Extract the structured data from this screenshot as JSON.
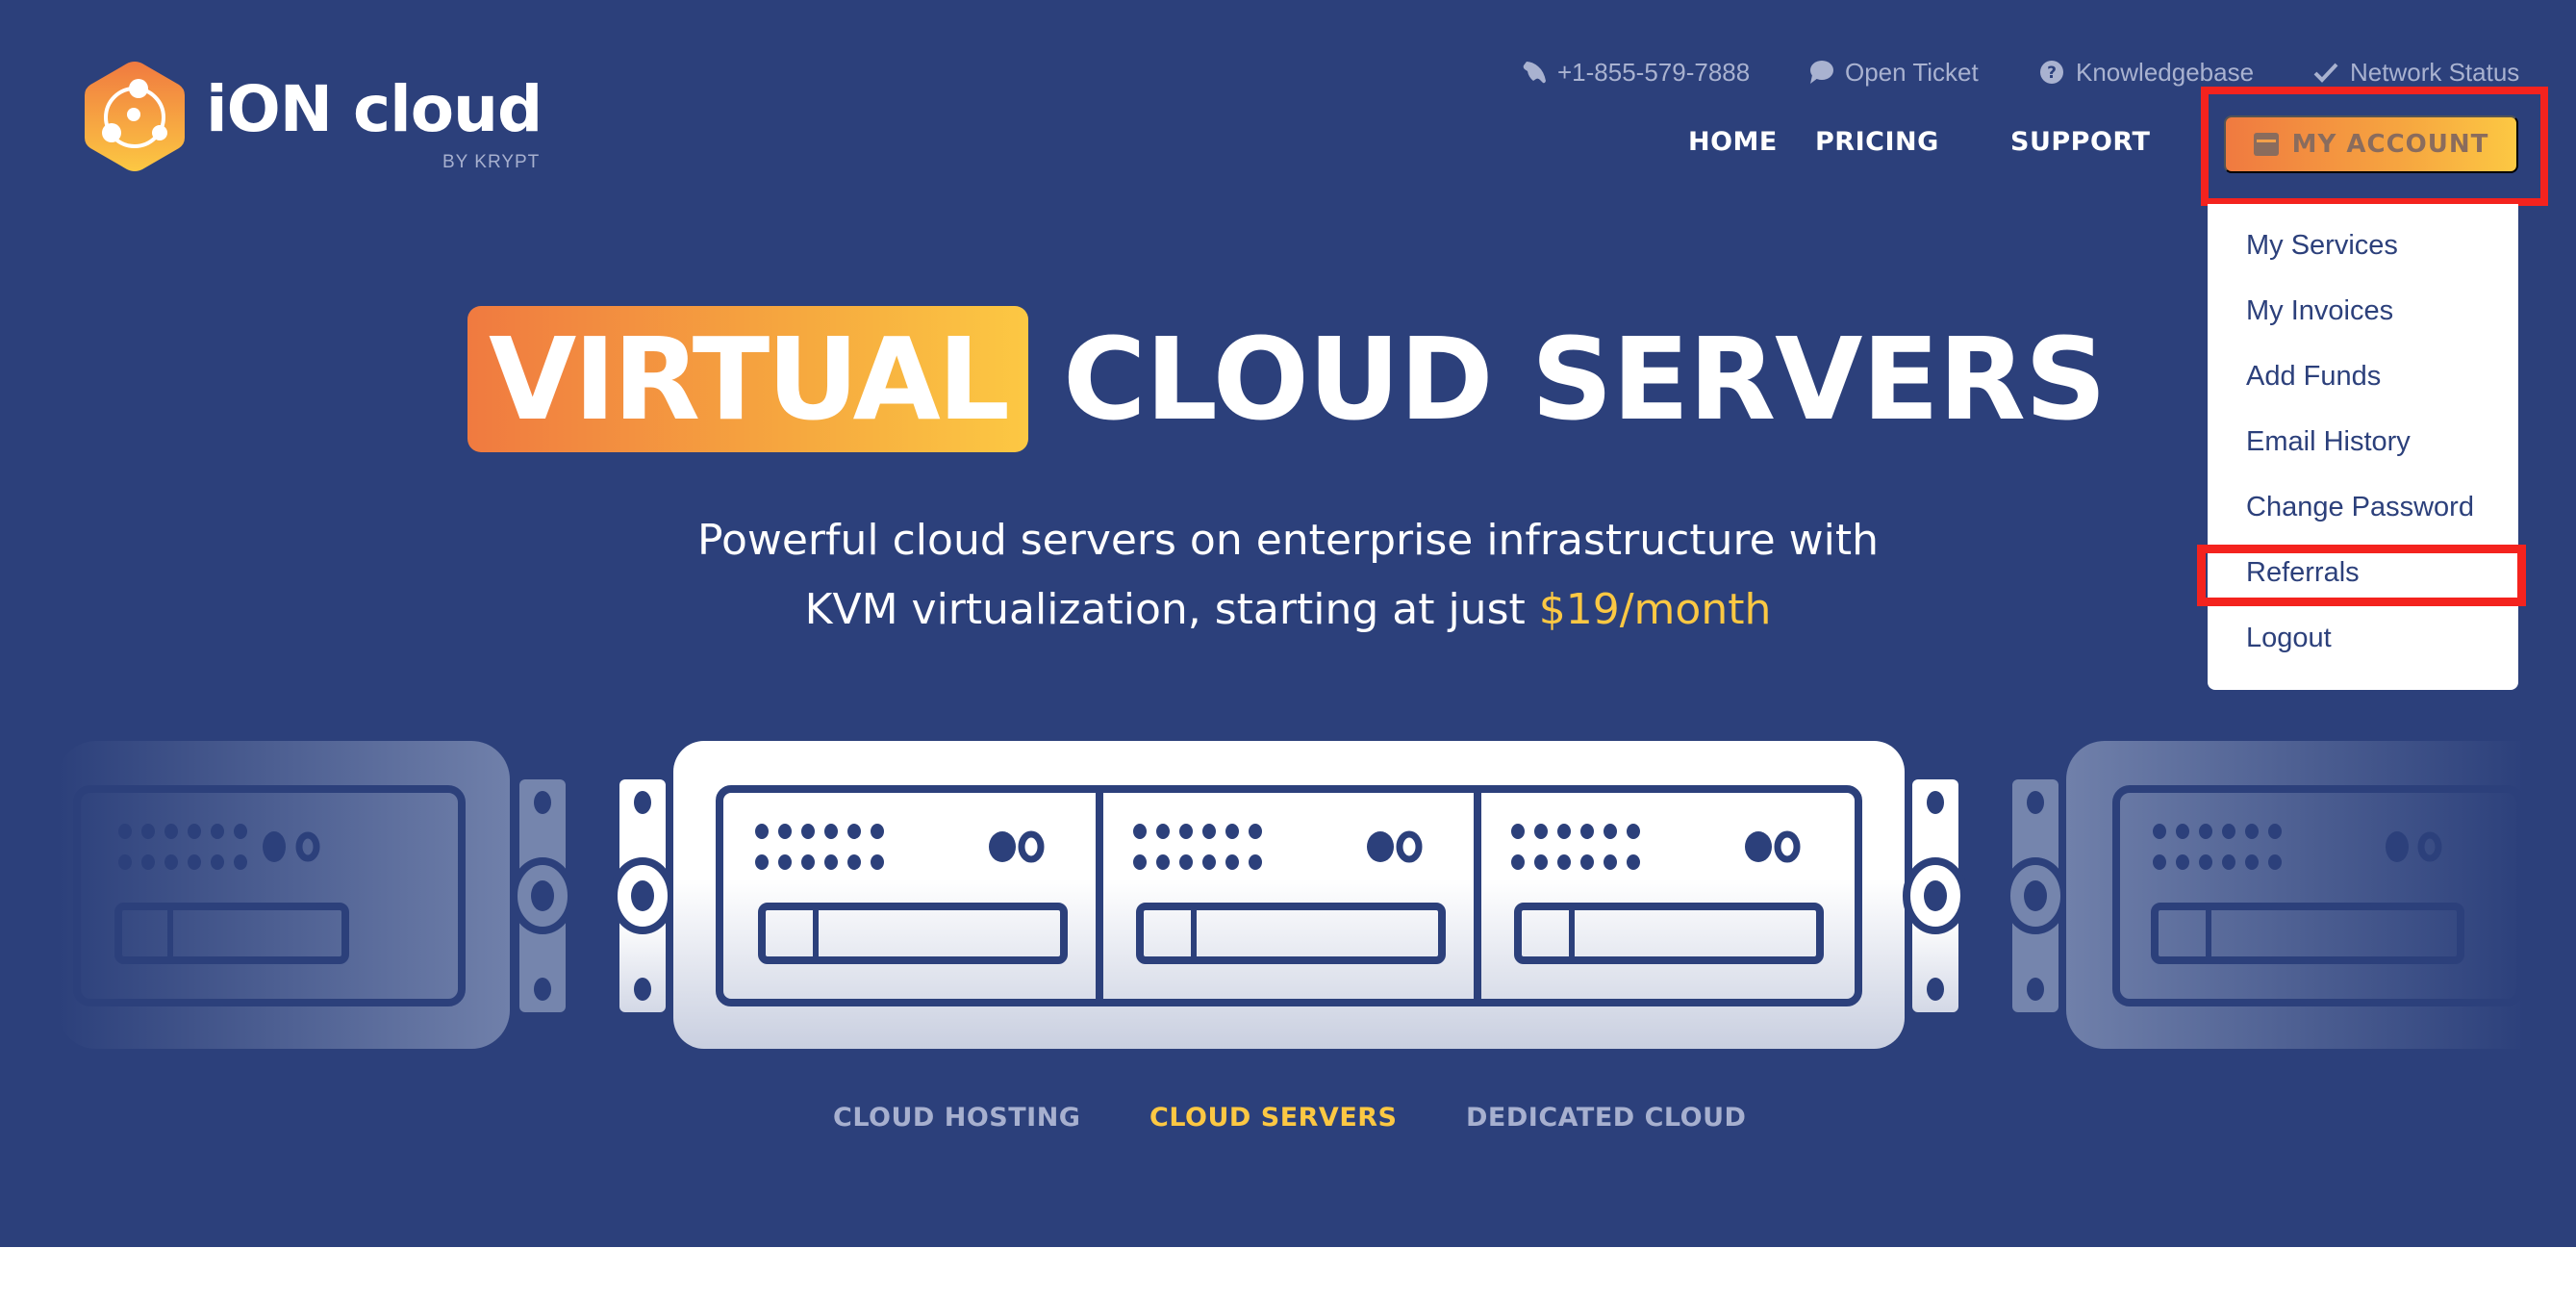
{
  "brand": {
    "name": "iON cloud",
    "byline": "BY KRYPT",
    "gradient": [
      "#f07a40",
      "#fcc843"
    ],
    "background": "#2c407b"
  },
  "utility_bar": [
    {
      "icon": "phone-icon",
      "label": "+1-855-579-7888"
    },
    {
      "icon": "chat-bubble-icon",
      "label": "Open Ticket"
    },
    {
      "icon": "question-circle-icon",
      "label": "Knowledgebase"
    },
    {
      "icon": "checkmark-icon",
      "label": "Network Status"
    }
  ],
  "nav": {
    "items": [
      {
        "label": "HOME"
      },
      {
        "label": "PRICING"
      },
      {
        "label": "SUPPORT"
      }
    ],
    "account_button": {
      "icon": "wallet-icon",
      "label": "MY ACCOUNT"
    }
  },
  "account_menu": {
    "items": [
      {
        "label": "My Services"
      },
      {
        "label": "My Invoices"
      },
      {
        "label": "Add Funds"
      },
      {
        "label": "Email History"
      },
      {
        "label": "Change Password"
      },
      {
        "label": "Referrals",
        "highlighted": true
      },
      {
        "label": "Logout"
      }
    ],
    "highlight_color": "#f4231e"
  },
  "hero": {
    "title_highlight": "VIRTUAL",
    "title_rest": "CLOUD SERVERS",
    "subtitle_line1": "Powerful cloud servers on enterprise infrastructure with",
    "subtitle_line2_prefix": "KVM virtualization, starting at just ",
    "subtitle_price": "$19/month",
    "price_color": "#fcc843"
  },
  "product_tabs": [
    {
      "label": "CLOUD HOSTING",
      "active": false
    },
    {
      "label": "CLOUD SERVERS",
      "active": true
    },
    {
      "label": "DEDICATED CLOUD",
      "active": false
    }
  ]
}
